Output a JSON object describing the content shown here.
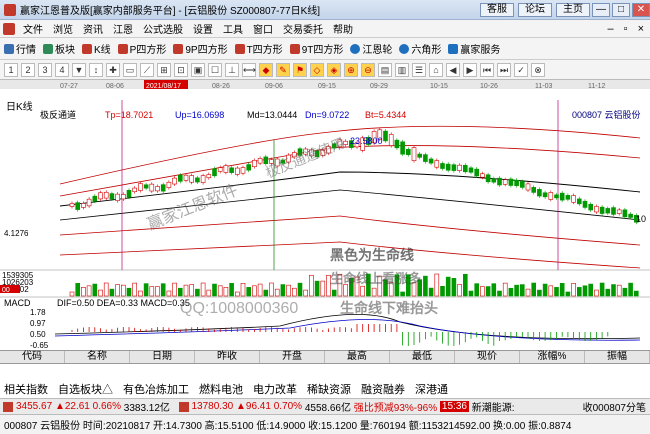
{
  "window": {
    "title": "赢家江恩普及版[赢家内部服务平台] - [云铝股份   SZ000807-77日K线]",
    "buttons": [
      "客服",
      "论坛",
      "主页"
    ],
    "win_controls": [
      "—",
      "□",
      "✕"
    ]
  },
  "menu": [
    "文件",
    "浏览",
    "资讯",
    "江恩",
    "公式选股",
    "设置",
    "工具",
    "窗口",
    "交易委托",
    "帮助"
  ],
  "toolbar": [
    "行情",
    "板块",
    "K线",
    "P四方形",
    "9P四方形",
    "T四方形",
    "9T四方形",
    "江恩轮",
    "六角形",
    "赢家服务"
  ],
  "toolbar2_icons": [
    "1",
    "2",
    "3",
    "4",
    "▼",
    "↕",
    "✚",
    "▭",
    "⟋",
    "⊞",
    "⊡",
    "▣",
    "☐",
    "⊥",
    "⟷",
    "◆",
    "✎",
    "⚑",
    "◇",
    "◈",
    "⊕",
    "⊖",
    "▤",
    "▥",
    "☰",
    "⌂",
    "◀",
    "▶",
    "⏮",
    "⏭",
    "✓",
    "⊗"
  ],
  "chart": {
    "period_label": "日K线",
    "indicator_name": "极反通道",
    "tp_label": "Tp=18.7021",
    "up_label": "Up=16.0698",
    "md_label": "Md=13.0444",
    "dn_label": "Dn=9.0722",
    "bt_label": "Bt=5.4344",
    "stock_name": "000807  云铝股份",
    "price_tag": "23.5800",
    "right_price": "10",
    "low_label": "4.1276",
    "volume_labels": [
      "1539305",
      "1026203",
      "513102"
    ],
    "volume_small": "00",
    "top_dates": [
      "07-27",
      "08-06",
      "2021/08/17",
      "08-26",
      "09-06",
      "09-15",
      "09-29",
      "10-15",
      "10-26",
      "11-03",
      "11-12"
    ],
    "macd_label": "MACD",
    "macd_values": "DIF=0.50   DEA=0.33   MACD=0.35",
    "macd_scale": [
      "1.78",
      "0.97",
      "0.50",
      "-0.65"
    ],
    "watermark_main": "赢家江恩软件",
    "watermark_diag": "极反通道使用",
    "watermark_black1": "黑色为生命线",
    "watermark_black2": "生命线上看涨多",
    "watermark_qq": "QQ:1008000360",
    "watermark_red": "生命线下难抬头"
  },
  "datebar": [
    "代码",
    "名称",
    "日期",
    "昨收",
    "开盘",
    "最高",
    "最低",
    "现价",
    "涨幅%",
    "振幅"
  ],
  "tabs": [
    "相关指数",
    "自选板块△",
    "有色冶炼加工",
    "燃料电池",
    "电力改革",
    "稀缺资源",
    "融资融券",
    "深港通"
  ],
  "status1": {
    "sh_index": "3455.67",
    "sh_change": "▲22.61",
    "sh_pct": "0.66%",
    "sh_amount": "3383.12亿",
    "sz_index": "13780.30",
    "sz_change": "▲96.41",
    "sz_pct": "0.70%",
    "sz_amount": "4558.66亿",
    "ratio": "强比预减93%-96%",
    "time": "15:36",
    "news": "新潮能源:",
    "receive": "收000807分笔"
  },
  "status2": "000807 云铝股份 时间:20210817 开:14.7300 高:15.5100 低:14.9000 收:15.1200 量:760194 额:1153214592.00 换:0.00 振:0.8874"
}
